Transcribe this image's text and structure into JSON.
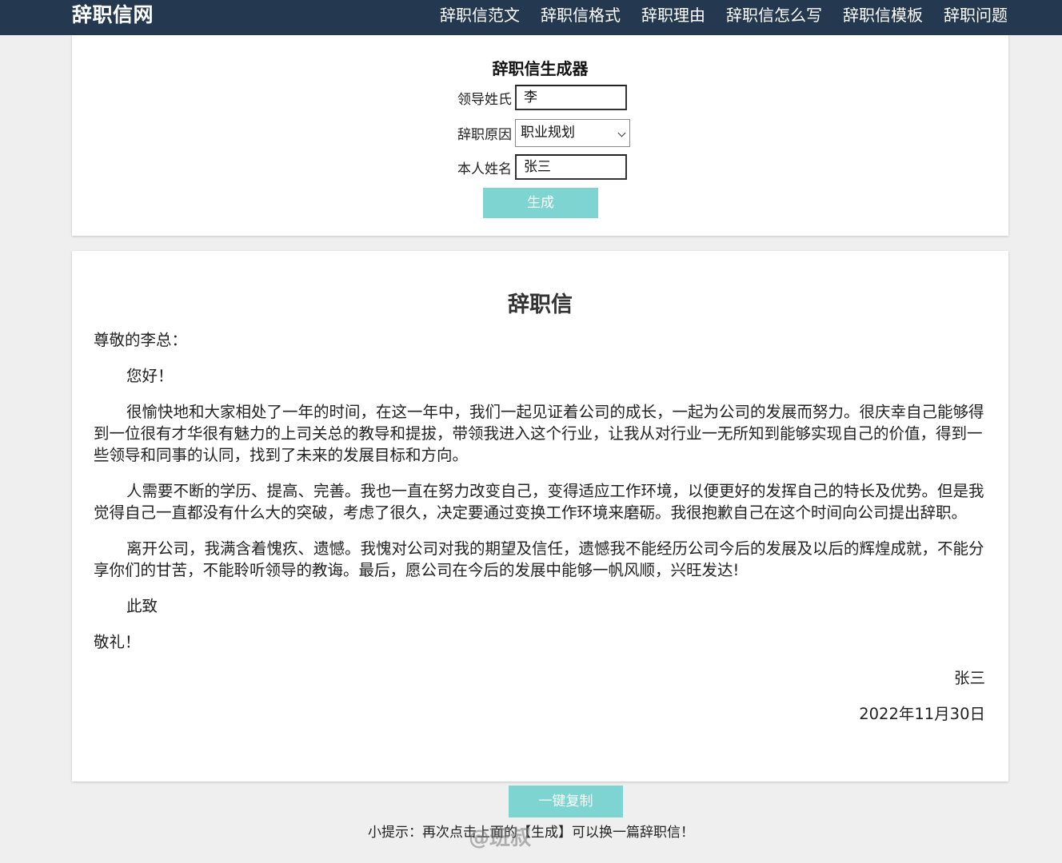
{
  "header": {
    "brand": "辞职信网",
    "nav": [
      "辞职信范文",
      "辞职信格式",
      "辞职理由",
      "辞职信怎么写",
      "辞职信模板",
      "辞职问题"
    ]
  },
  "form": {
    "title": "辞职信生成器",
    "leader_label": "领导姓氏",
    "leader_value": "李",
    "reason_label": "辞职原因",
    "reason_value": "职业规划",
    "name_label": "本人姓名",
    "name_value": "张三",
    "generate_label": "生成"
  },
  "letter": {
    "title": "辞职信",
    "salutation": "尊敬的李总：",
    "greeting": "您好！",
    "paragraphs": [
      "很愉快地和大家相处了一年的时间，在这一年中，我们一起见证着公司的成长，一起为公司的发展而努力。很庆幸自己能够得到一位很有才华很有魅力的上司关总的教导和提拔，带领我进入这个行业，让我从对行业一无所知到能够实现自己的价值，得到一些领导和同事的认同，找到了未来的发展目标和方向。",
      "人需要不断的学历、提高、完善。我也一直在努力改变自己，变得适应工作环境，以便更好的发挥自己的特长及优势。但是我觉得自己一直都没有什么大的突破，考虑了很久，决定要通过变换工作环境来磨砺。我很抱歉自己在这个时间向公司提出辞职。",
      "离开公司，我满含着愧疚、遗憾。我愧对公司对我的期望及信任，遗憾我不能经历公司今后的发展及以后的辉煌成就，不能分享你们的甘苦，不能聆听领导的教诲。最后，愿公司在今后的发展中能够一帆风顺，兴旺发达!"
    ],
    "closing_1": "此致",
    "closing_2": "敬礼！",
    "signature": "张三",
    "date": "2022年11月30日"
  },
  "actions": {
    "copy_label": "一键复制",
    "tip": "小提示：再次点击上面的【生成】可以换一篇辞职信！"
  },
  "watermark": "@班叔"
}
